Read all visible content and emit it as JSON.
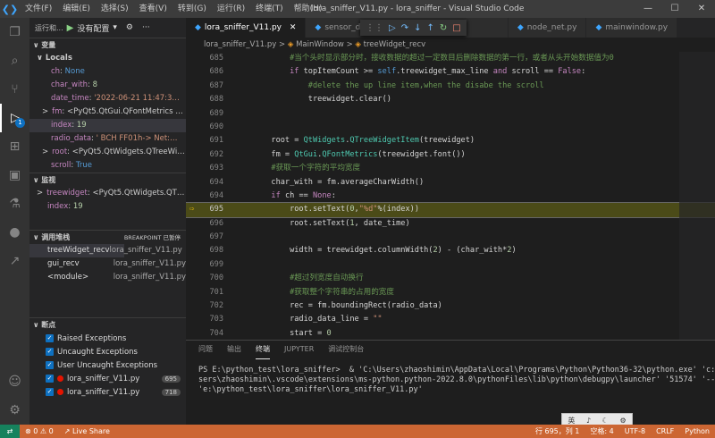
{
  "titlebar": {
    "menus": [
      "文件(F)",
      "编辑(E)",
      "选择(S)",
      "查看(V)",
      "转到(G)",
      "运行(R)",
      "终端(T)",
      "帮助(H)"
    ],
    "title": "lora_sniffer_V11.py - lora_sniffer - Visual Studio Code",
    "minimize": "—",
    "maximize": "☐",
    "close": "✕"
  },
  "activity": {
    "debug_badge": "1"
  },
  "sidebar": {
    "run_label": "运行和...",
    "config_label": "没有配置",
    "variables_header": "变量",
    "locals_label": "Locals",
    "variables": [
      {
        "name": "ch",
        "value": "None",
        "type": "bool",
        "arrow": ""
      },
      {
        "name": "char_with",
        "value": "8",
        "type": "num",
        "arrow": ""
      },
      {
        "name": "date_time",
        "value": "'2022-06-21 11:47:3…",
        "type": "str",
        "arrow": ""
      },
      {
        "name": "fm",
        "value": "<PyQt5.QtGui.QFontMetrics …",
        "type": "obj",
        "arrow": ">"
      },
      {
        "name": "index",
        "value": "19",
        "type": "num",
        "arrow": ""
      },
      {
        "name": "radio_data",
        "value": "' BCH FF01h-> Net:…",
        "type": "str",
        "arrow": ""
      },
      {
        "name": "root",
        "value": "<PyQt5.QtWidgets.QTreeWi…",
        "type": "obj",
        "arrow": ">"
      },
      {
        "name": "scroll",
        "value": "True",
        "type": "bool",
        "arrow": ""
      }
    ],
    "watch_header": "监视",
    "watch": [
      {
        "name": "treewidget",
        "value": "<PyQt5.QtWidgets.QT…",
        "arrow": ">"
      },
      {
        "name": "index",
        "value": "19",
        "arrow": ""
      }
    ],
    "callstack_header": "调用堆栈",
    "callstack_status": "BREAKPOINT 已暂停",
    "callstack": [
      {
        "func": "treeWidget_recv",
        "file": "lora_sniffer_V11.py"
      },
      {
        "func": "gui_recv",
        "file": "lora_sniffer_V11.py"
      },
      {
        "func": "<module>",
        "file": "lora_sniffer_V11.py"
      }
    ],
    "breakpoints_header": "断点",
    "breakpoints": [
      {
        "label": "Raised Exceptions",
        "kind": "check",
        "line": ""
      },
      {
        "label": "Uncaught Exceptions",
        "kind": "check",
        "line": ""
      },
      {
        "label": "User Uncaught Exceptions",
        "kind": "check",
        "line": ""
      },
      {
        "label": "lora_sniffer_V11.py",
        "kind": "dot",
        "line": "695"
      },
      {
        "label": "lora_sniffer_V11.py",
        "kind": "dot",
        "line": "718"
      }
    ]
  },
  "editor": {
    "tabs": [
      "lora_sniffer_V11.py",
      "sensor_da…",
      "node_net.py",
      "mainwindow.py"
    ],
    "breadcrumb": [
      "lora_sniffer_V11.py",
      "MainWindow",
      "treeWidget_recv"
    ],
    "current_line": "695",
    "lines": [
      {
        "n": "685",
        "t": "            #当个头时显示部分时，接收数据的超过一定数目后删除数据的第一行，或者从头开始数据值为0"
      },
      {
        "n": "686",
        "t": "            if topItemCount >= self.treewidget_max_line and scroll == False:"
      },
      {
        "n": "687",
        "t": "                #delete the up line item,when the disabe the scroll"
      },
      {
        "n": "688",
        "t": "                treewidget.clear()"
      },
      {
        "n": "689",
        "t": ""
      },
      {
        "n": "690",
        "t": ""
      },
      {
        "n": "691",
        "t": "        root = QtWidgets.QTreeWidgetItem(treewidget)"
      },
      {
        "n": "692",
        "t": "        fm = QtGui.QFontMetrics(treewidget.font())"
      },
      {
        "n": "693",
        "t": "        #获取一个字符的平均宽度"
      },
      {
        "n": "694",
        "t": "        char_with = fm.averageCharWidth()"
      },
      {
        "n": "694",
        "t": "        if ch == None:"
      },
      {
        "n": "695",
        "t": "            root.setText(0,\"%d\"%(index))"
      },
      {
        "n": "696",
        "t": "            root.setText(1, date_time)"
      },
      {
        "n": "697",
        "t": ""
      },
      {
        "n": "698",
        "t": "            width = treewidget.columnWidth(2) - (char_with*2)"
      },
      {
        "n": "699",
        "t": ""
      },
      {
        "n": "700",
        "t": "            #超过列宽度自动换行"
      },
      {
        "n": "701",
        "t": "            #获取整个字符串的占用的宽度"
      },
      {
        "n": "702",
        "t": "            rec = fm.boundingRect(radio_data)"
      },
      {
        "n": "703",
        "t": "            radio_data_line = \"\""
      },
      {
        "n": "704",
        "t": "            start = 0"
      },
      {
        "n": "705",
        "t": ""
      },
      {
        "n": "706",
        "t": "            while start < len(radio_data):"
      },
      {
        "n": "707",
        "t": "                if rec.width() > width:"
      },
      {
        "n": "708",
        "t": "                    end = width // char_with"
      },
      {
        "n": "709",
        "t": "                    #判断字符串中有汉字的情况"
      },
      {
        "n": "710",
        "t": "                    while len(radio_data[start:start+end].encode(\"gb2312\")) > width//(char_with;"
      }
    ]
  },
  "panel": {
    "tabs": [
      "问题",
      "输出",
      "终端",
      "JUPYTER",
      "调试控制台"
    ],
    "active_tab": "终端",
    "terminal": [
      "PS E:\\python_test\\lora_sniffer>  & 'C:\\Users\\zhaoshimin\\AppData\\Local\\Programs\\Python\\Python36-32\\python.exe' 'c:\\U",
      "sers\\zhaoshimin\\.vscode\\extensions\\ms-python.python-2022.8.0\\pythonFiles\\lib\\python\\debugpy\\launcher' '51574' '--' 'c",
      "'e:\\python_test\\lora_sniffer\\lora_sniffer_V11.py'"
    ]
  },
  "ime": {
    "items": [
      "英",
      "♪",
      "☾",
      "⚙"
    ]
  },
  "statusbar": {
    "remote": "⇄",
    "problems": "⊗ 0 ⚠ 0",
    "live_share": "Live Share",
    "position": "行 695，列 1",
    "spaces": "空格: 4",
    "encoding": "UTF-8",
    "eol": "CRLF",
    "language": "Python"
  }
}
